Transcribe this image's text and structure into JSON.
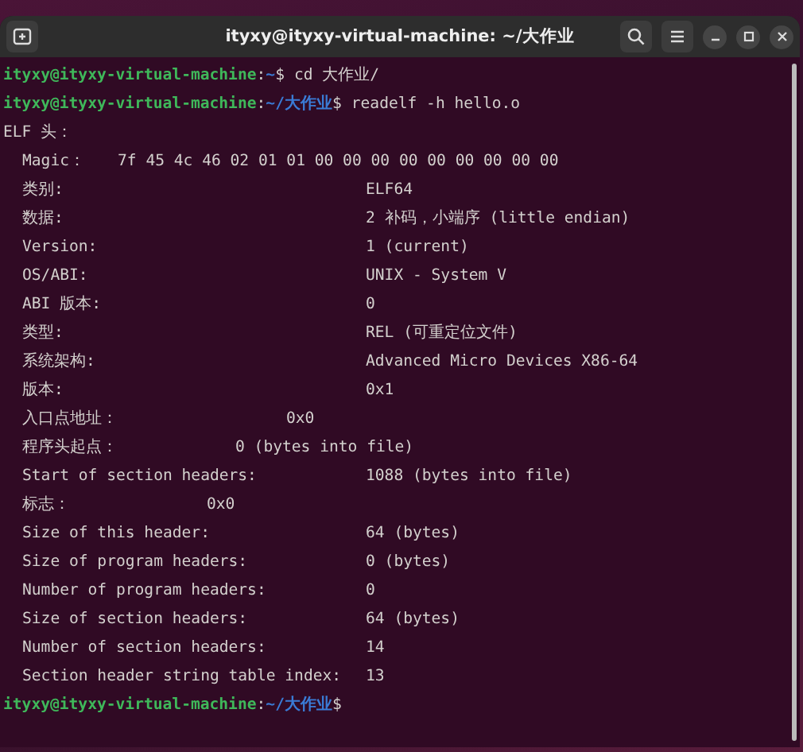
{
  "window": {
    "title": "ityxy@ityxy-virtual-machine: ~/大作业"
  },
  "terminal": {
    "lines": [
      {
        "kind": "prompt",
        "user": "ityxy@ityxy-virtual-machine",
        "sep": ":",
        "path": "~",
        "dollar": "$",
        "command": "cd 大作业/"
      },
      {
        "kind": "prompt",
        "user": "ityxy@ityxy-virtual-machine",
        "sep": ":",
        "path": "~/大作业",
        "dollar": "$",
        "command": "readelf -h hello.o"
      },
      {
        "kind": "heading",
        "text": "ELF 头："
      },
      {
        "kind": "magic",
        "label": "Magic：",
        "value": "7f 45 4c 46 02 01 01 00 00 00 00 00 00 00 00 00"
      },
      {
        "kind": "field",
        "label": "类别:",
        "value": "ELF64"
      },
      {
        "kind": "field",
        "label": "数据:",
        "value": "2 补码，小端序 (little endian)"
      },
      {
        "kind": "field",
        "label": "Version:",
        "value": "1 (current)"
      },
      {
        "kind": "field",
        "label": "OS/ABI:",
        "value": "UNIX - System V"
      },
      {
        "kind": "field",
        "label": "ABI 版本:",
        "value": "0"
      },
      {
        "kind": "field",
        "label": "类型:",
        "value": "REL (可重定位文件)"
      },
      {
        "kind": "field",
        "label": "系统架构:",
        "value": "Advanced Micro Devices X86-64"
      },
      {
        "kind": "field",
        "label": "版本:",
        "value": "0x1"
      },
      {
        "kind": "loose",
        "label": "入口点地址：",
        "value": "0x0"
      },
      {
        "kind": "loose",
        "label": "程序头起点：",
        "value": "0 (bytes into file)"
      },
      {
        "kind": "field",
        "label": "Start of section headers:",
        "value": "1088 (bytes into file)"
      },
      {
        "kind": "loose",
        "label": "标志：",
        "value": "0x0"
      },
      {
        "kind": "field",
        "label": "Size of this header:",
        "value": "64 (bytes)"
      },
      {
        "kind": "field",
        "label": "Size of program headers:",
        "value": "0 (bytes)"
      },
      {
        "kind": "field",
        "label": "Number of program headers:",
        "value": "0"
      },
      {
        "kind": "field",
        "label": "Size of section headers:",
        "value": "64 (bytes)"
      },
      {
        "kind": "field",
        "label": "Number of section headers:",
        "value": "14"
      },
      {
        "kind": "field",
        "label": "Section header string table index:",
        "value": "13"
      },
      {
        "kind": "prompt",
        "user": "ityxy@ityxy-virtual-machine",
        "sep": ":",
        "path": "~/大作业",
        "dollar": "$"
      }
    ]
  }
}
